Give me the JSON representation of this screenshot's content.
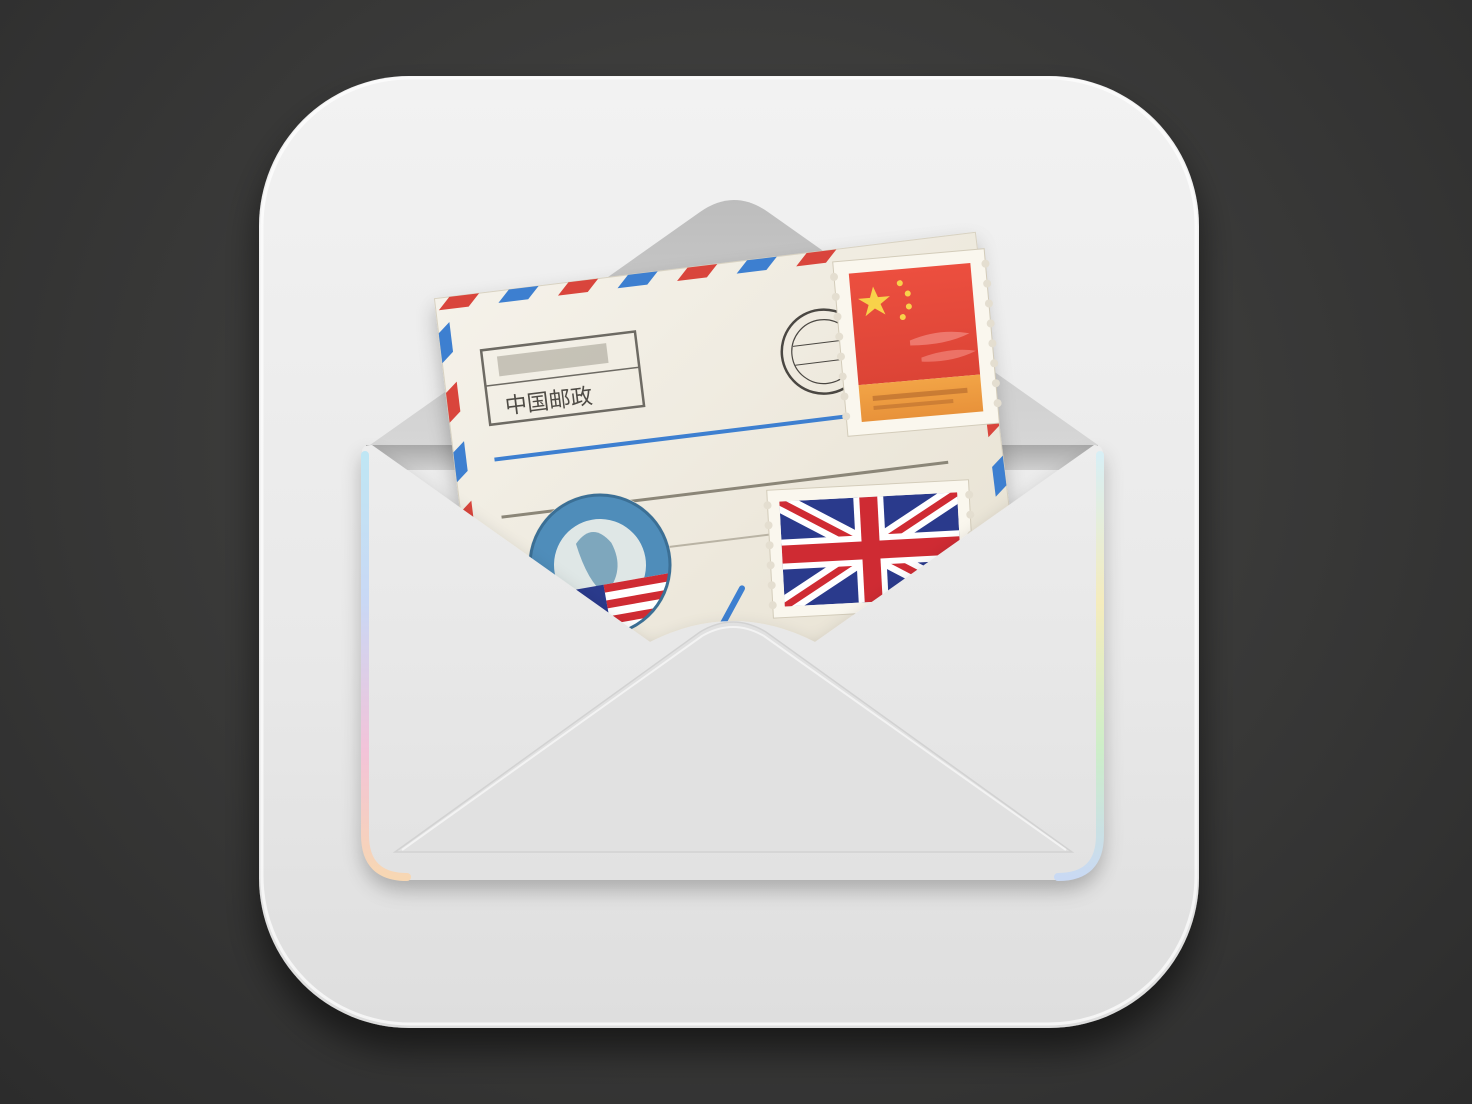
{
  "icon": {
    "name": "mail-app-icon",
    "colors": {
      "background": "#3b3b3a",
      "tile": "#ededed",
      "envelope": "#e6e6e6",
      "airmail_red": "#d9453c",
      "airmail_blue": "#3d7fd0",
      "letter_paper": "#f1ede2",
      "china_stamp_red": "#e5473a",
      "china_stamp_orange": "#ee9a3f",
      "uk_blue": "#2a3a8c",
      "uk_red": "#cf2b33"
    }
  },
  "letter": {
    "header_box_text": "中国邮政"
  },
  "stamps": [
    {
      "name": "china-flag-stamp",
      "icon": "china-flag"
    },
    {
      "name": "uk-flag-stamp",
      "icon": "union-jack"
    },
    {
      "name": "usa-postmark-stamp",
      "icon": "us-flag"
    }
  ]
}
